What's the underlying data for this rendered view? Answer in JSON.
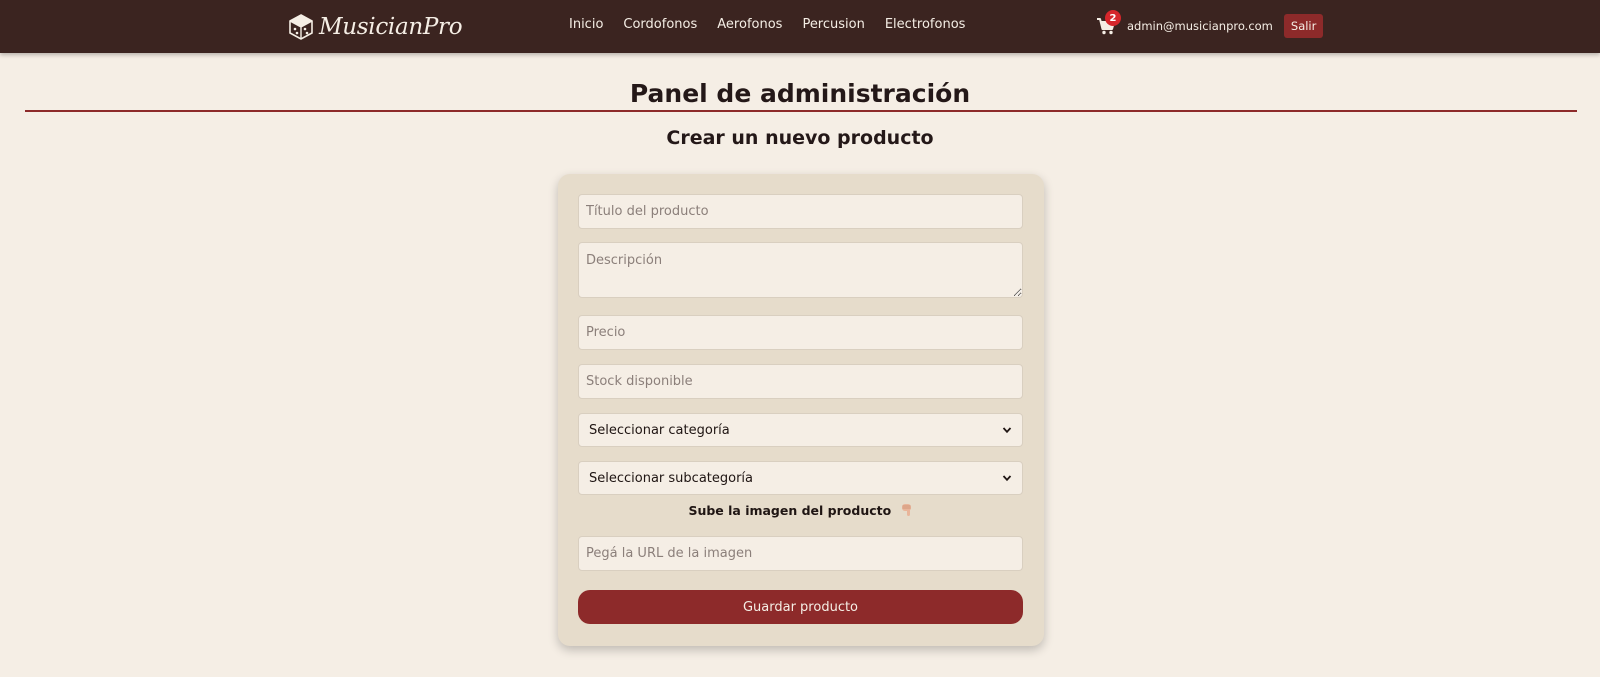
{
  "brand": {
    "name": "MusicianPro",
    "logo_icon": "dice-cube-icon"
  },
  "nav": {
    "links": [
      "Inicio",
      "Cordofonos",
      "Aerofonos",
      "Percusion",
      "Electrofonos"
    ]
  },
  "user": {
    "cart_icon": "cart-icon",
    "cart_count": "2",
    "email": "admin@musicianpro.com",
    "logout_label": "Salir"
  },
  "page": {
    "title": "Panel de administración",
    "section_title": "Crear un nuevo producto"
  },
  "form": {
    "title_placeholder": "Título del producto",
    "description_placeholder": "Descripción",
    "price_placeholder": "Precio",
    "stock_placeholder": "Stock disponible",
    "category_selected": "Seleccionar categoría",
    "subcategory_selected": "Seleccionar subcategoría",
    "upload_label": "Sube la imagen del producto",
    "upload_icon": "pointing-down-hand-icon",
    "image_url_placeholder": "Pegá la URL de la imagen",
    "save_label": "Guardar producto"
  },
  "colors": {
    "navbar": "#3b2420",
    "background": "#f5eee5",
    "accent": "#8d2a2a",
    "card": "#e6dccb",
    "badge": "#d6262b"
  }
}
